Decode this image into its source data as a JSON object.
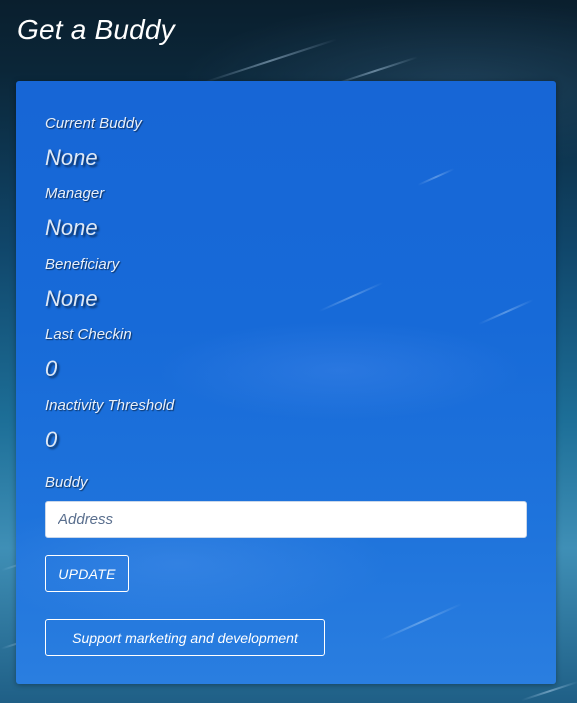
{
  "header": {
    "title": "Get a Buddy"
  },
  "fields": [
    {
      "label": "Current Buddy",
      "value": "None"
    },
    {
      "label": "Manager",
      "value": "None"
    },
    {
      "label": "Beneficiary",
      "value": "None"
    },
    {
      "label": "Last Checkin",
      "value": "0"
    },
    {
      "label": "Inactivity Threshold",
      "value": "0"
    }
  ],
  "buddy_input": {
    "label": "Buddy",
    "placeholder": "Address",
    "value": ""
  },
  "buttons": {
    "update_label": "UPDATE",
    "support_label": "Support marketing and development"
  },
  "colors": {
    "card_background": "#176ad8",
    "page_background_top": "#0a1f2e",
    "text": "#ffffff"
  }
}
